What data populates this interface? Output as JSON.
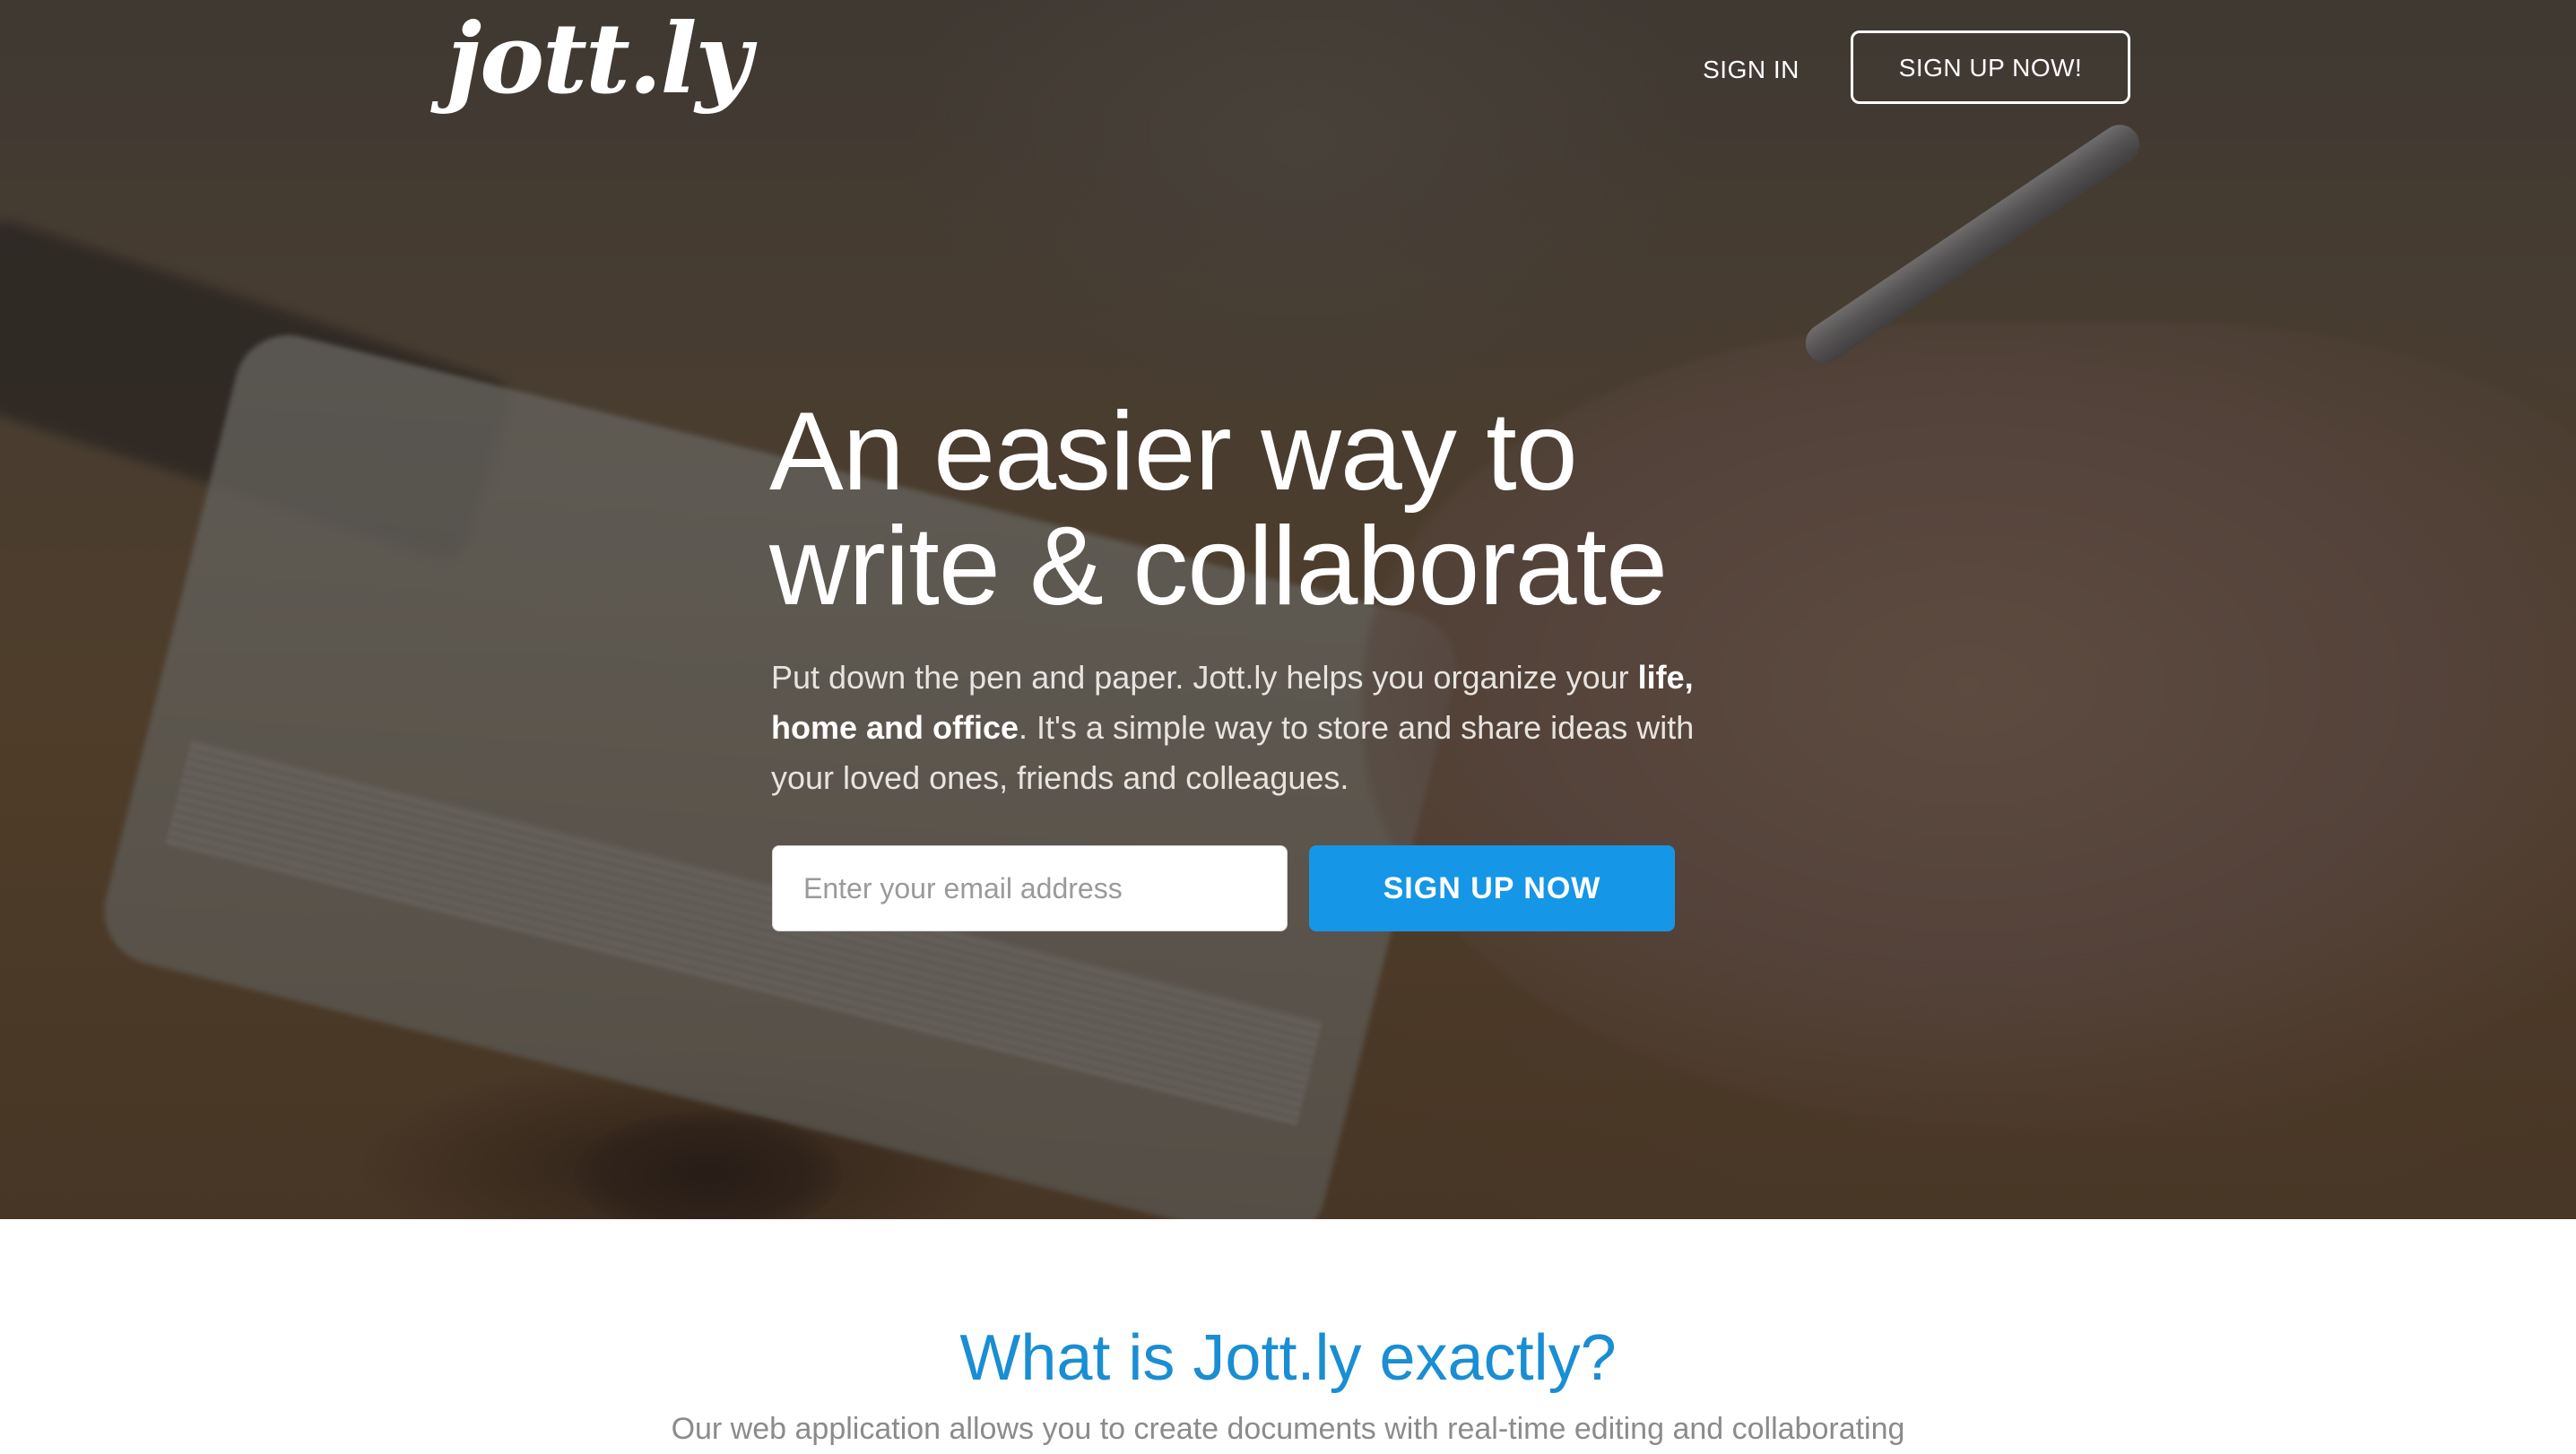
{
  "brand": {
    "logo_text": "jott.ly"
  },
  "nav": {
    "signin_label": "SIGN IN",
    "signup_label": "SIGN UP NOW!"
  },
  "hero": {
    "headline_line1": "An easier way to",
    "headline_line2": "write & collaborate",
    "sub_part1": "Put down the pen and paper. Jott.ly helps you organize your ",
    "sub_bold": "life, home and office",
    "sub_part2": ". It's a simple way to store and share ideas with your loved ones, friends and colleagues.",
    "email_placeholder": "Enter your email address",
    "email_value": "",
    "cta_label": "SIGN UP NOW"
  },
  "about": {
    "title": "What is Jott.ly exactly?",
    "text": "Our web application allows you to create documents with real-time editing and collaborating"
  },
  "colors": {
    "accent": "#1696e6",
    "section_title": "#1a8ed3",
    "hero_overlay": "rgba(35,32,30,0.5)"
  }
}
